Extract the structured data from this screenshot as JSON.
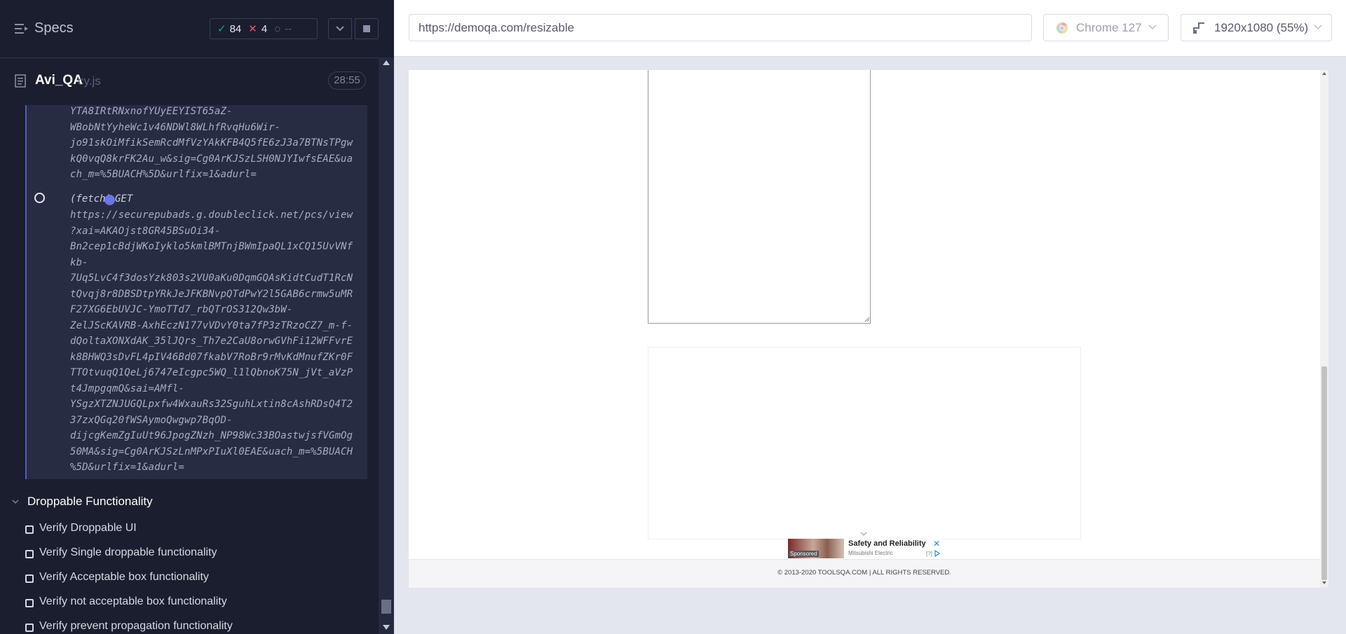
{
  "reporter": {
    "specs_label": "Specs",
    "stats": {
      "passed": "84",
      "failed": "4",
      "pending": "--"
    },
    "file": {
      "name": "Avi_QA",
      "ext": "cy.js",
      "duration": "28:55"
    },
    "log": {
      "previous_url_tail": "YTA8IRtRNxnofYUyEEYIST65aZ-\nWBobNtYyheWc1v46NDWl8WLhfRvqHu6Wir-\njo91skOiMfikSemRcdMfVzYAkKFB4Q5fE6zJ3a7BTNsTPgw\nkQ0vqQ8krFK2Au_w&sig=Cg0ArKJSzLSH0NJYIwfsEAE&ua\nch_m=%5BUACH%5D&urlfix=1&adurl=",
      "fetch_label": "(fetch)",
      "fetch_method": "GET",
      "fetch_url": "https://securepubads.g.doubleclick.net/pcs/view\n?xai=AKAOjst8GR45BSuOi34-\nBn2cep1cBdjWKoIyklo5kmlBMTnjBWmIpaQL1xCQ15UvVNf\nkb-\n7Uq5LvC4f3dosYzk803s2VU0aKu0DqmGQAsKidtCudT1RcN\ntQvqj8r8DBSDtpYRkJeJFKBNvpQTdPwY2l5GAB6crmw5uMR\nF27XG6EbUVJC-YmoTTd7_rbQTrOS312Qw3bW-\nZelJScKAVRB-AxhEczN177vVDvY0ta7fP3zTRzoCZ7_m-f-\ndQoltaXONXdAK_35lJQrs_Th7e2CaU8orwGVhFi12WFFvrE\nk8BHWQ3sDvFL4pIV46Bd07fkabV7RoBr9rMvKdMnufZKr0F\nTTOtvuqQ1QeLj6747eIcgpc5WQ_l1lQbnoK75N_jVt_aVzP\nt4JmpgqmQ&sai=AMfl-\nYSgzXTZNJUGQLpxfw4WxauRs32SguhLxtin8cAshRDsQ4T2\n37zxQGq20fWSAymoQwgwp7BqOD-\ndijcgKemZgIuUt96JpogZNzh_NP98Wc33BOastwjsfVGmOg\n50MA&sig=Cg0ArKJSzLnMPxPIuXl0EAE&uach_m=%5BUACH\n%5D&urlfix=1&adurl="
    },
    "suite": {
      "title": "Droppable Functionality",
      "tests": [
        "Verify Droppable UI",
        "Verify Single droppable functionality",
        "Verify Acceptable box functionality",
        "Verify not acceptable box functionality",
        "Verify prevent propagation functionality"
      ]
    }
  },
  "aut": {
    "url": "https://demoqa.com/resizable",
    "browser": "Chrome 127",
    "viewport": "1920x1080  (55%)",
    "ad": {
      "title": "Safety and Reliability",
      "advertiser": "Mitsubishi Electric",
      "sponsored": "Sponsored",
      "qmark": "[?]",
      "close": "✕"
    },
    "footer": "© 2013-2020 TOOLSQA.COM | ALL RIGHTS RESERVED."
  },
  "colors": {
    "reporter_bg": "#1b1e2e",
    "passed": "#1fa971",
    "failed": "#e45770",
    "accent": "#4f5ac9"
  },
  "icons": [
    "specs-list-icon",
    "check-icon",
    "x-icon",
    "spinner-icon",
    "chevron-down-icon",
    "stop-icon",
    "file-icon",
    "chrome-icon",
    "viewport-icon"
  ]
}
